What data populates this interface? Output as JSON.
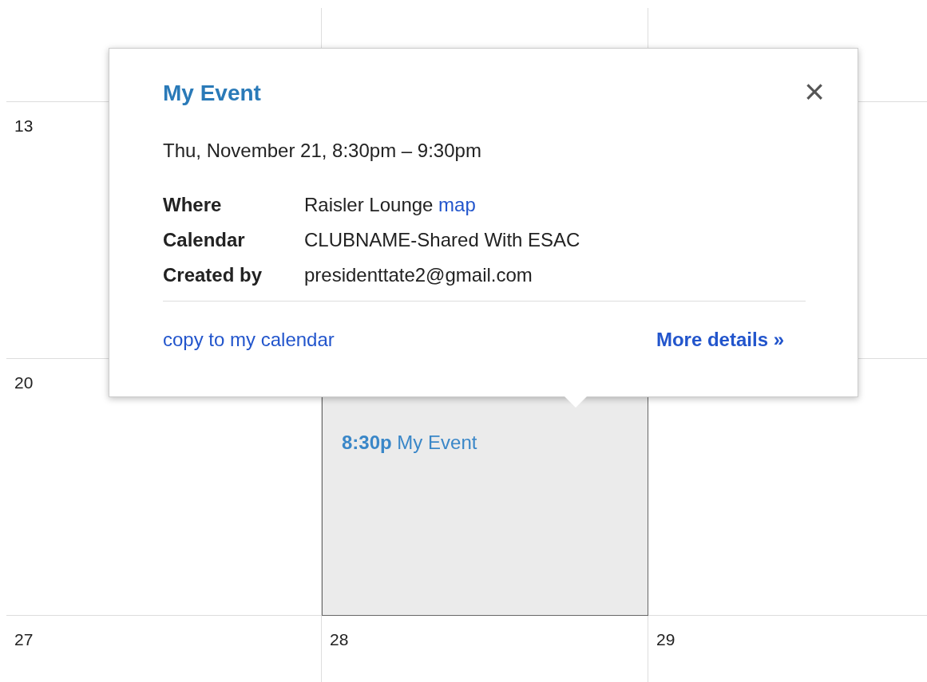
{
  "calendar": {
    "day_numbers": [
      "13",
      "20",
      "27",
      "28",
      "29"
    ],
    "events": [
      {
        "time": "8:30p",
        "title": "My Event",
        "selected": true
      }
    ]
  },
  "popup": {
    "title": "My Event",
    "close": "×",
    "when": "Thu, November 21, 8:30pm – 9:30pm",
    "details": [
      {
        "label": "Where",
        "value": "Raisler Lounge",
        "link": "map"
      },
      {
        "label": "Calendar",
        "value": "CLUBNAME-Shared With ESAC"
      },
      {
        "label": "Created by",
        "value": "presidenttate2@gmail.com"
      }
    ],
    "copy_link": "copy to my calendar",
    "more_link": "More details »"
  }
}
